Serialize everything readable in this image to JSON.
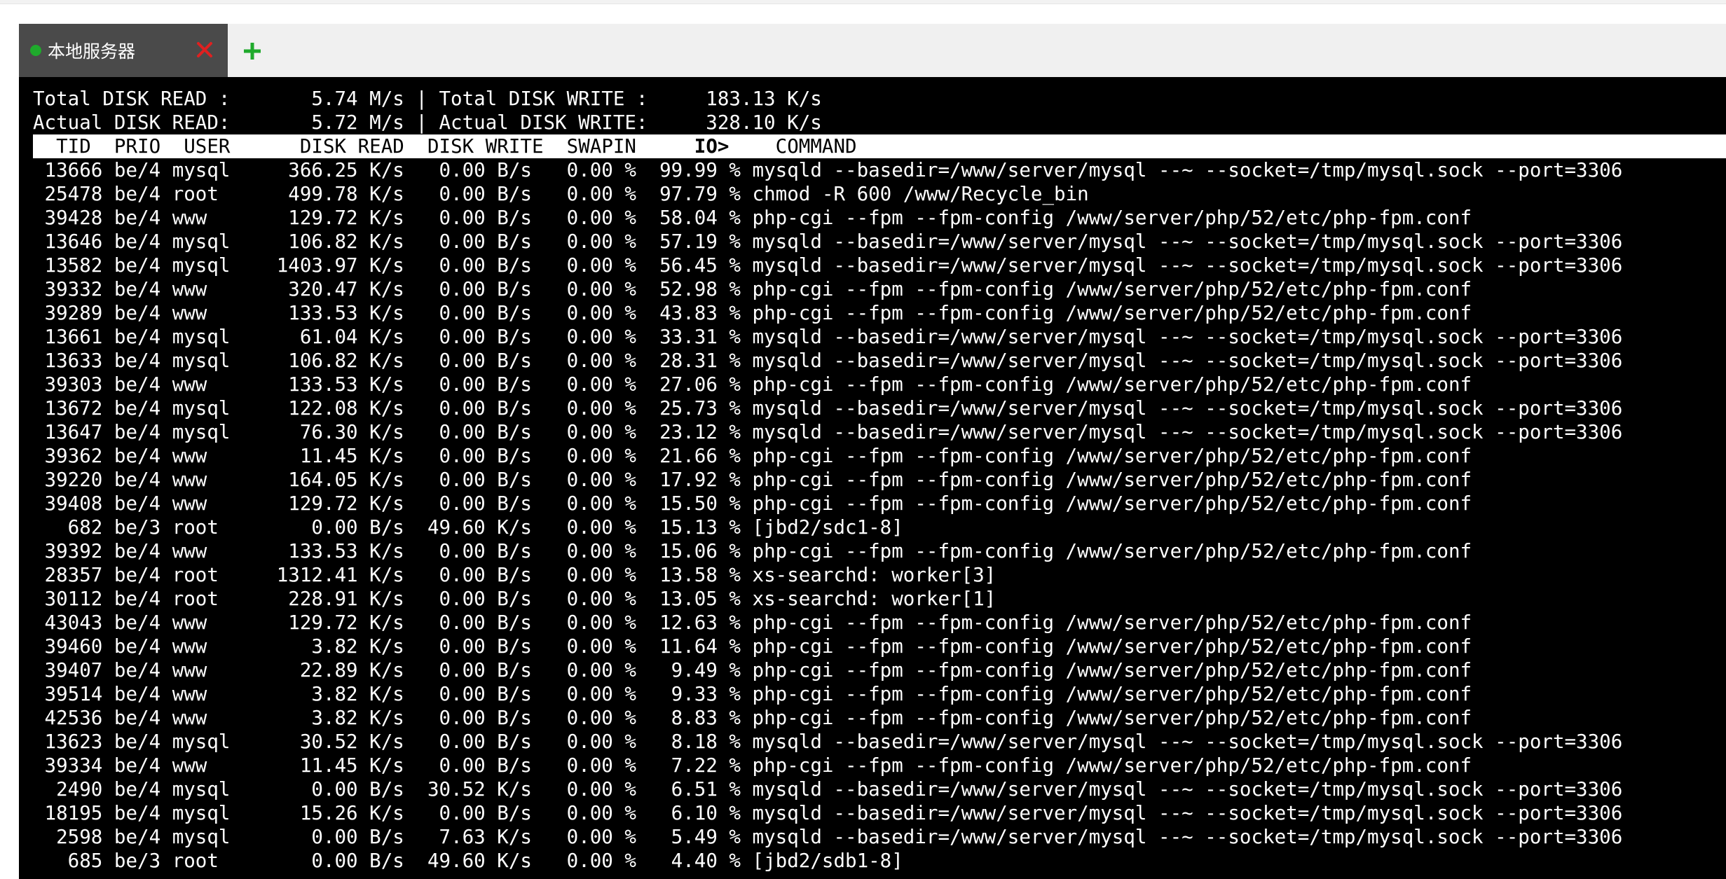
{
  "window": {
    "tab": {
      "title": "本地服务器",
      "status": "connected",
      "status_color": "#1faa2c",
      "close_icon": "close-icon",
      "close_color": "#e02020"
    },
    "add_tab_icon": "plus-icon",
    "add_tab_color": "#1faa2c"
  },
  "terminal": {
    "summary": [
      "Total DISK READ :       5.74 M/s | Total DISK WRITE :     183.13 K/s",
      "Actual DISK READ:       5.72 M/s | Actual DISK WRITE:     328.10 K/s"
    ],
    "header": {
      "tid": "  TID",
      "prio": "PRIO",
      "user": "USER",
      "disk_read": "DISK READ",
      "disk_write": "DISK WRITE",
      "swapin": "SWAPIN",
      "io": "IO>",
      "command": "COMMAND"
    },
    "rows": [
      {
        "tid": "13666",
        "prio": "be/4",
        "user": "mysql",
        "read": "366.25 K/s",
        "write": "0.00 B/s",
        "swapin": "0.00 %",
        "io": "99.99 %",
        "command": "mysqld --basedir=/www/server/mysql --~ --socket=/tmp/mysql.sock --port=3306"
      },
      {
        "tid": "25478",
        "prio": "be/4",
        "user": "root",
        "read": "499.78 K/s",
        "write": "0.00 B/s",
        "swapin": "0.00 %",
        "io": "97.79 %",
        "command": "chmod -R 600 /www/Recycle_bin"
      },
      {
        "tid": "39428",
        "prio": "be/4",
        "user": "www",
        "read": "129.72 K/s",
        "write": "0.00 B/s",
        "swapin": "0.00 %",
        "io": "58.04 %",
        "command": "php-cgi --fpm --fpm-config /www/server/php/52/etc/php-fpm.conf"
      },
      {
        "tid": "13646",
        "prio": "be/4",
        "user": "mysql",
        "read": "106.82 K/s",
        "write": "0.00 B/s",
        "swapin": "0.00 %",
        "io": "57.19 %",
        "command": "mysqld --basedir=/www/server/mysql --~ --socket=/tmp/mysql.sock --port=3306"
      },
      {
        "tid": "13582",
        "prio": "be/4",
        "user": "mysql",
        "read": "1403.97 K/s",
        "write": "0.00 B/s",
        "swapin": "0.00 %",
        "io": "56.45 %",
        "command": "mysqld --basedir=/www/server/mysql --~ --socket=/tmp/mysql.sock --port=3306"
      },
      {
        "tid": "39332",
        "prio": "be/4",
        "user": "www",
        "read": "320.47 K/s",
        "write": "0.00 B/s",
        "swapin": "0.00 %",
        "io": "52.98 %",
        "command": "php-cgi --fpm --fpm-config /www/server/php/52/etc/php-fpm.conf"
      },
      {
        "tid": "39289",
        "prio": "be/4",
        "user": "www",
        "read": "133.53 K/s",
        "write": "0.00 B/s",
        "swapin": "0.00 %",
        "io": "43.83 %",
        "command": "php-cgi --fpm --fpm-config /www/server/php/52/etc/php-fpm.conf"
      },
      {
        "tid": "13661",
        "prio": "be/4",
        "user": "mysql",
        "read": "61.04 K/s",
        "write": "0.00 B/s",
        "swapin": "0.00 %",
        "io": "33.31 %",
        "command": "mysqld --basedir=/www/server/mysql --~ --socket=/tmp/mysql.sock --port=3306"
      },
      {
        "tid": "13633",
        "prio": "be/4",
        "user": "mysql",
        "read": "106.82 K/s",
        "write": "0.00 B/s",
        "swapin": "0.00 %",
        "io": "28.31 %",
        "command": "mysqld --basedir=/www/server/mysql --~ --socket=/tmp/mysql.sock --port=3306"
      },
      {
        "tid": "39303",
        "prio": "be/4",
        "user": "www",
        "read": "133.53 K/s",
        "write": "0.00 B/s",
        "swapin": "0.00 %",
        "io": "27.06 %",
        "command": "php-cgi --fpm --fpm-config /www/server/php/52/etc/php-fpm.conf"
      },
      {
        "tid": "13672",
        "prio": "be/4",
        "user": "mysql",
        "read": "122.08 K/s",
        "write": "0.00 B/s",
        "swapin": "0.00 %",
        "io": "25.73 %",
        "command": "mysqld --basedir=/www/server/mysql --~ --socket=/tmp/mysql.sock --port=3306"
      },
      {
        "tid": "13647",
        "prio": "be/4",
        "user": "mysql",
        "read": "76.30 K/s",
        "write": "0.00 B/s",
        "swapin": "0.00 %",
        "io": "23.12 %",
        "command": "mysqld --basedir=/www/server/mysql --~ --socket=/tmp/mysql.sock --port=3306"
      },
      {
        "tid": "39362",
        "prio": "be/4",
        "user": "www",
        "read": "11.45 K/s",
        "write": "0.00 B/s",
        "swapin": "0.00 %",
        "io": "21.66 %",
        "command": "php-cgi --fpm --fpm-config /www/server/php/52/etc/php-fpm.conf"
      },
      {
        "tid": "39220",
        "prio": "be/4",
        "user": "www",
        "read": "164.05 K/s",
        "write": "0.00 B/s",
        "swapin": "0.00 %",
        "io": "17.92 %",
        "command": "php-cgi --fpm --fpm-config /www/server/php/52/etc/php-fpm.conf"
      },
      {
        "tid": "39408",
        "prio": "be/4",
        "user": "www",
        "read": "129.72 K/s",
        "write": "0.00 B/s",
        "swapin": "0.00 %",
        "io": "15.50 %",
        "command": "php-cgi --fpm --fpm-config /www/server/php/52/etc/php-fpm.conf"
      },
      {
        "tid": "682",
        "prio": "be/3",
        "user": "root",
        "read": "0.00 B/s",
        "write": "49.60 K/s",
        "swapin": "0.00 %",
        "io": "15.13 %",
        "command": "[jbd2/sdc1-8]"
      },
      {
        "tid": "39392",
        "prio": "be/4",
        "user": "www",
        "read": "133.53 K/s",
        "write": "0.00 B/s",
        "swapin": "0.00 %",
        "io": "15.06 %",
        "command": "php-cgi --fpm --fpm-config /www/server/php/52/etc/php-fpm.conf"
      },
      {
        "tid": "28357",
        "prio": "be/4",
        "user": "root",
        "read": "1312.41 K/s",
        "write": "0.00 B/s",
        "swapin": "0.00 %",
        "io": "13.58 %",
        "command": "xs-searchd: worker[3]"
      },
      {
        "tid": "30112",
        "prio": "be/4",
        "user": "root",
        "read": "228.91 K/s",
        "write": "0.00 B/s",
        "swapin": "0.00 %",
        "io": "13.05 %",
        "command": "xs-searchd: worker[1]"
      },
      {
        "tid": "43043",
        "prio": "be/4",
        "user": "www",
        "read": "129.72 K/s",
        "write": "0.00 B/s",
        "swapin": "0.00 %",
        "io": "12.63 %",
        "command": "php-cgi --fpm --fpm-config /www/server/php/52/etc/php-fpm.conf"
      },
      {
        "tid": "39460",
        "prio": "be/4",
        "user": "www",
        "read": "3.82 K/s",
        "write": "0.00 B/s",
        "swapin": "0.00 %",
        "io": "11.64 %",
        "command": "php-cgi --fpm --fpm-config /www/server/php/52/etc/php-fpm.conf"
      },
      {
        "tid": "39407",
        "prio": "be/4",
        "user": "www",
        "read": "22.89 K/s",
        "write": "0.00 B/s",
        "swapin": "0.00 %",
        "io": "9.49 %",
        "command": "php-cgi --fpm --fpm-config /www/server/php/52/etc/php-fpm.conf"
      },
      {
        "tid": "39514",
        "prio": "be/4",
        "user": "www",
        "read": "3.82 K/s",
        "write": "0.00 B/s",
        "swapin": "0.00 %",
        "io": "9.33 %",
        "command": "php-cgi --fpm --fpm-config /www/server/php/52/etc/php-fpm.conf"
      },
      {
        "tid": "42536",
        "prio": "be/4",
        "user": "www",
        "read": "3.82 K/s",
        "write": "0.00 B/s",
        "swapin": "0.00 %",
        "io": "8.83 %",
        "command": "php-cgi --fpm --fpm-config /www/server/php/52/etc/php-fpm.conf"
      },
      {
        "tid": "13623",
        "prio": "be/4",
        "user": "mysql",
        "read": "30.52 K/s",
        "write": "0.00 B/s",
        "swapin": "0.00 %",
        "io": "8.18 %",
        "command": "mysqld --basedir=/www/server/mysql --~ --socket=/tmp/mysql.sock --port=3306"
      },
      {
        "tid": "39334",
        "prio": "be/4",
        "user": "www",
        "read": "11.45 K/s",
        "write": "0.00 B/s",
        "swapin": "0.00 %",
        "io": "7.22 %",
        "command": "php-cgi --fpm --fpm-config /www/server/php/52/etc/php-fpm.conf"
      },
      {
        "tid": "2490",
        "prio": "be/4",
        "user": "mysql",
        "read": "0.00 B/s",
        "write": "30.52 K/s",
        "swapin": "0.00 %",
        "io": "6.51 %",
        "command": "mysqld --basedir=/www/server/mysql --~ --socket=/tmp/mysql.sock --port=3306"
      },
      {
        "tid": "18195",
        "prio": "be/4",
        "user": "mysql",
        "read": "15.26 K/s",
        "write": "0.00 B/s",
        "swapin": "0.00 %",
        "io": "6.10 %",
        "command": "mysqld --basedir=/www/server/mysql --~ --socket=/tmp/mysql.sock --port=3306"
      },
      {
        "tid": "2598",
        "prio": "be/4",
        "user": "mysql",
        "read": "0.00 B/s",
        "write": "7.63 K/s",
        "swapin": "0.00 %",
        "io": "5.49 %",
        "command": "mysqld --basedir=/www/server/mysql --~ --socket=/tmp/mysql.sock --port=3306"
      },
      {
        "tid": "685",
        "prio": "be/3",
        "user": "root",
        "read": "0.00 B/s",
        "write": "49.60 K/s",
        "swapin": "0.00 %",
        "io": "4.40 %",
        "command": "[jbd2/sdb1-8]"
      }
    ]
  }
}
